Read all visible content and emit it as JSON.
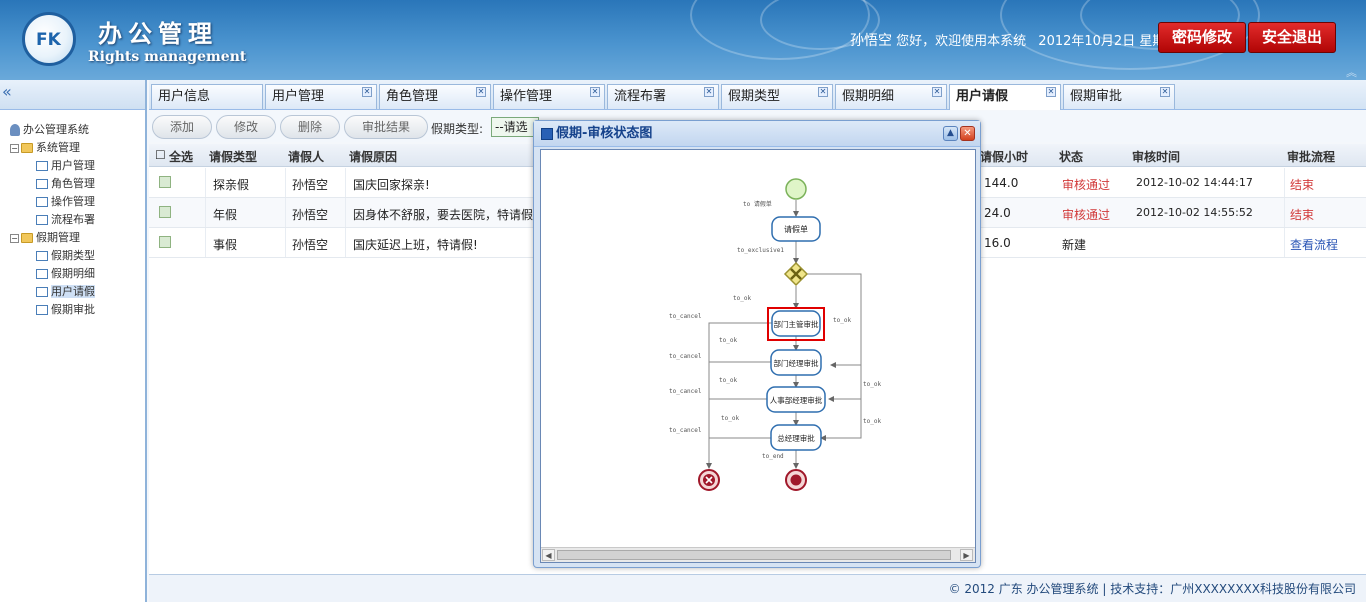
{
  "header": {
    "logo_text": "FK",
    "title": "办公管理",
    "subtitle": "Rights management",
    "user": "孙悟空",
    "greeting": "您好，欢迎使用本系统",
    "date": "2012年10月2日 星期二",
    "change_password": "密码修改",
    "logout": "安全退出"
  },
  "sidebar": {
    "collapse_glyph": "«",
    "tree": {
      "root": "办公管理系统",
      "groups": [
        {
          "label": "系统管理",
          "items": [
            "用户管理",
            "角色管理",
            "操作管理",
            "流程布署"
          ]
        },
        {
          "label": "假期管理",
          "items": [
            "假期类型",
            "假期明细",
            "用户请假",
            "假期审批"
          ]
        }
      ]
    }
  },
  "tabs": [
    "用户信息",
    "用户管理",
    "角色管理",
    "操作管理",
    "流程布署",
    "假期类型",
    "假期明细",
    "用户请假",
    "假期审批"
  ],
  "active_tab": "用户请假",
  "toolbar": {
    "add": "添加",
    "edit": "修改",
    "delete": "删除",
    "approval_result": "审批结果",
    "type_label": "假期类型:",
    "type_value": "--请选"
  },
  "grid": {
    "columns": {
      "select_all": "全选",
      "type": "请假类型",
      "person": "请假人",
      "reason": "请假原因",
      "hours": "请假小时",
      "status": "状态",
      "audit_time": "审核时间",
      "flow": "审批流程"
    },
    "rows": [
      {
        "type": "探亲假",
        "person": "孙悟空",
        "reason": "国庆回家探亲!",
        "hours": "144.0",
        "status": "审核通过",
        "audit_time": "2012-10-02 14:44:17",
        "flow": "结束"
      },
      {
        "type": "年假",
        "person": "孙悟空",
        "reason": "因身体不舒服，要去医院，特请假",
        "hours": "24.0",
        "status": "审核通过",
        "audit_time": "2012-10-02 14:55:52",
        "flow": "结束"
      },
      {
        "type": "事假",
        "person": "孙悟空",
        "reason": "国庆延迟上班，特请假!",
        "hours": "16.0",
        "status": "新建",
        "audit_time": "",
        "flow": "查看流程"
      }
    ]
  },
  "dialog": {
    "title": "假期-审核状态图",
    "min_glyph": "▲",
    "close_glyph": "✕",
    "nodes": {
      "apply": "请假单",
      "dept_head": "部门主管审批",
      "dept_manager": "部门经理审批",
      "hr_manager": "人事部经理审批",
      "gm": "总经理审批"
    },
    "edges": {
      "to_apply": "to 请假单",
      "to_exclusive": "to_exclusive1",
      "to_ok": "to_ok",
      "to_cancel": "to_cancel",
      "to_end": "to_end"
    }
  },
  "footer": "© 2012 广东 办公管理系统 | 技术支持：广州XXXXXXXX科技股份有限公司",
  "colors": {
    "header_blue": "#2a76b9",
    "button_red": "#c80f0f",
    "status_ok": "#d23a3a",
    "link_blue": "#2a55b5",
    "highlight_box": "#e00000"
  }
}
